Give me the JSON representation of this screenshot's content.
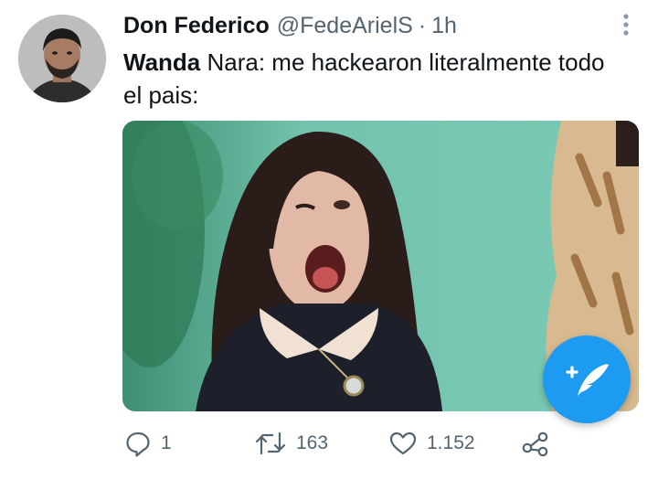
{
  "tweet": {
    "author_name": "Don Federico",
    "author_handle": "@FedeArielS",
    "separator": "·",
    "time": "1h",
    "text_bold": "Wanda",
    "text_rest": " Nara: me hackearon literalmente todo el pais:"
  },
  "actions": {
    "replies": "1",
    "retweets": "163",
    "likes": "1.152"
  },
  "icons": {
    "more": "more-vertical-icon",
    "reply": "reply-icon",
    "retweet": "retweet-icon",
    "like": "heart-icon",
    "share": "share-icon",
    "compose": "compose-tweet-icon"
  },
  "colors": {
    "accent": "#1d9bf0",
    "muted_text": "#536471",
    "primary_text": "#0f1419"
  }
}
